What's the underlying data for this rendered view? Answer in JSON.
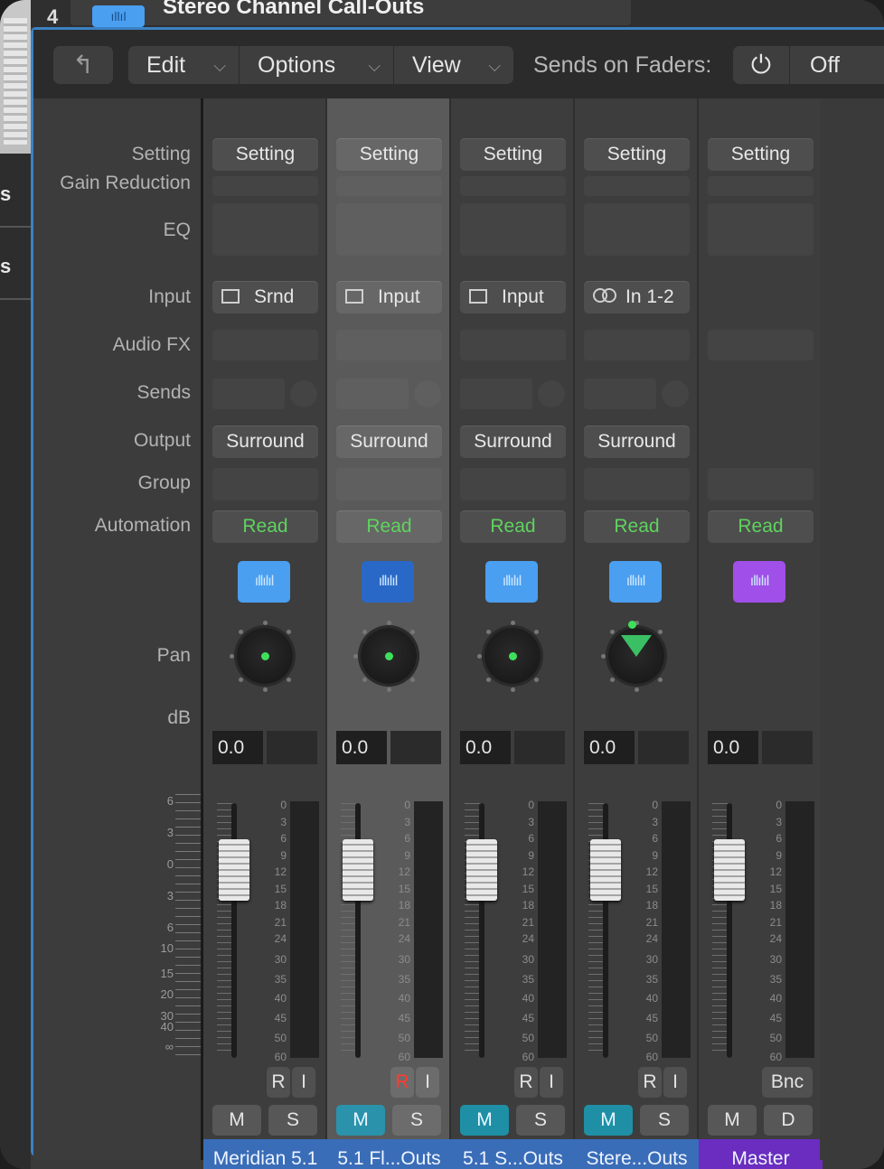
{
  "window": {
    "track_number": "4",
    "title": "Stereo Channel Call-Outs"
  },
  "background": {
    "fragments": [
      "s",
      "s"
    ]
  },
  "toolbar": {
    "up_icon": "up-arrow-icon",
    "edit": "Edit",
    "options": "Options",
    "view": "View",
    "sends_on_faders_label": "Sends on Faders:",
    "power_icon": "power-icon",
    "sends_value": "Off"
  },
  "labels": {
    "setting": "Setting",
    "gain_reduction": "Gain Reduction",
    "eq": "EQ",
    "input": "Input",
    "audio_fx": "Audio FX",
    "sends": "Sends",
    "output": "Output",
    "group": "Group",
    "automation": "Automation",
    "pan": "Pan",
    "db": "dB"
  },
  "fader_scale": [
    "6",
    "3",
    "0",
    "3",
    "6",
    "10",
    "15",
    "20",
    "30",
    "40",
    "∞"
  ],
  "meter_scale": [
    "0",
    "3",
    "6",
    "9",
    "12",
    "15",
    "18",
    "21",
    "24",
    "30",
    "35",
    "40",
    "45",
    "50",
    "60"
  ],
  "strips": [
    {
      "setting": "Setting",
      "input": "Srnd",
      "input_icon": "surround-input-icon",
      "output": "Surround",
      "automation": "Read",
      "waveform_icon": "waveform-icon",
      "waveform_color": "#4a9ff0",
      "db": "0.0",
      "r": "R",
      "i": "I",
      "m": "M",
      "s": "S",
      "mute_active": false,
      "name": "Meridian 5.1"
    },
    {
      "setting": "Setting",
      "input": "Input",
      "input_icon": "surround-input-icon",
      "output": "Surround",
      "automation": "Read",
      "waveform_icon": "waveform-icon",
      "waveform_color": "#2a68c8",
      "db": "0.0",
      "r": "R",
      "i": "I",
      "r_armed": true,
      "m": "M",
      "s": "S",
      "mute_active": true,
      "name": "5.1 Fl...Outs"
    },
    {
      "setting": "Setting",
      "input": "Input",
      "input_icon": "surround-input-icon",
      "output": "Surround",
      "automation": "Read",
      "waveform_icon": "waveform-icon",
      "waveform_color": "#4a9ff0",
      "db": "0.0",
      "r": "R",
      "i": "I",
      "m": "M",
      "s": "S",
      "mute_active": true,
      "name": "5.1 S...Outs"
    },
    {
      "setting": "Setting",
      "input": "In 1-2",
      "input_icon": "stereo-link-icon",
      "output": "Surround",
      "automation": "Read",
      "waveform_icon": "waveform-icon",
      "waveform_color": "#4a9ff0",
      "db": "0.0",
      "r": "R",
      "i": "I",
      "m": "M",
      "s": "S",
      "mute_active": true,
      "name": "Stere...Outs"
    },
    {
      "setting": "Setting",
      "automation": "Read",
      "waveform_icon": "waveform-icon",
      "waveform_color": "#a04fe8",
      "db": "0.0",
      "bnc": "Bnc",
      "m": "M",
      "d": "D",
      "name": "Master"
    }
  ],
  "colors": {
    "accent_blue": "#3a6db8",
    "master_purple": "#6a2dbf",
    "mute_teal": "#1f8fa6",
    "read_green": "#5fd35f",
    "pan_green": "#3ee05b"
  }
}
